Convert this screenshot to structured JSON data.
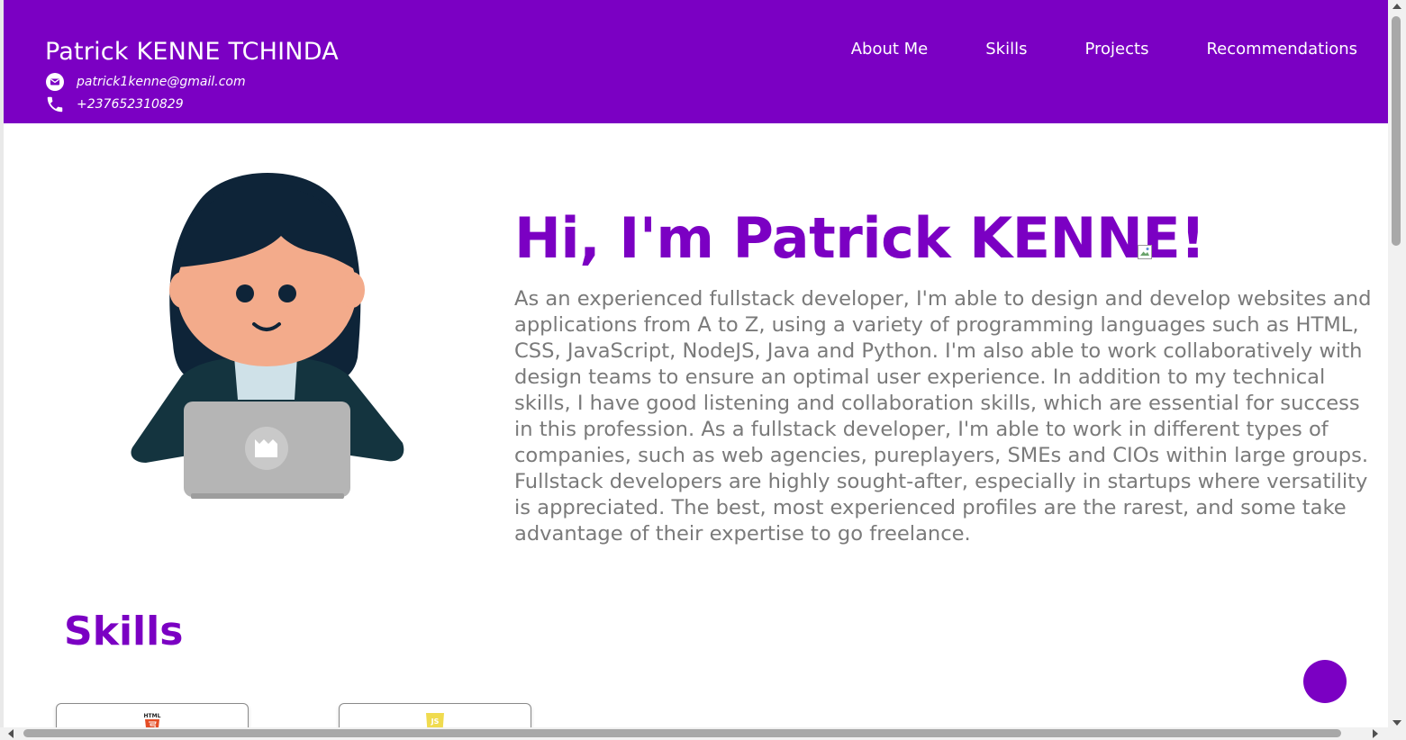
{
  "header": {
    "name": "Patrick KENNE TCHINDA",
    "email": "patrick1kenne@gmail.com",
    "phone": "+237652310829",
    "email_icon": "mail-icon",
    "phone_icon": "phone-icon",
    "nav": [
      {
        "label": "About Me"
      },
      {
        "label": "Skills"
      },
      {
        "label": "Projects"
      },
      {
        "label": "Recommendations"
      }
    ]
  },
  "hero": {
    "title": "Hi, I'm Patrick KENNE!",
    "description": "As an experienced fullstack developer, I'm able to design and develop websites and applications from A to Z, using a variety of programming languages such as HTML, CSS, JavaScript, NodeJS, Java and Python. I'm also able to work collaboratively with design teams to ensure an optimal user experience. In addition to my technical skills, I have good listening and collaboration skills, which are essential for success in this profession. As a fullstack developer, I'm able to work in different types of companies, such as web agencies, pureplayers, SMEs and CIOs within large groups. Fullstack developers are highly sought-after, especially in startups where versatility is appreciated. The best, most experienced profiles are the rarest, and some take advantage of their expertise to go freelance."
  },
  "skills": {
    "title": "Skills",
    "cards": [
      {
        "logo_text": "HTML",
        "icon": "html5-icon"
      },
      {
        "logo_text": "JS",
        "icon": "javascript-icon"
      }
    ]
  },
  "colors": {
    "brand": "#7b00c3",
    "text_muted": "#7a7a7a"
  }
}
